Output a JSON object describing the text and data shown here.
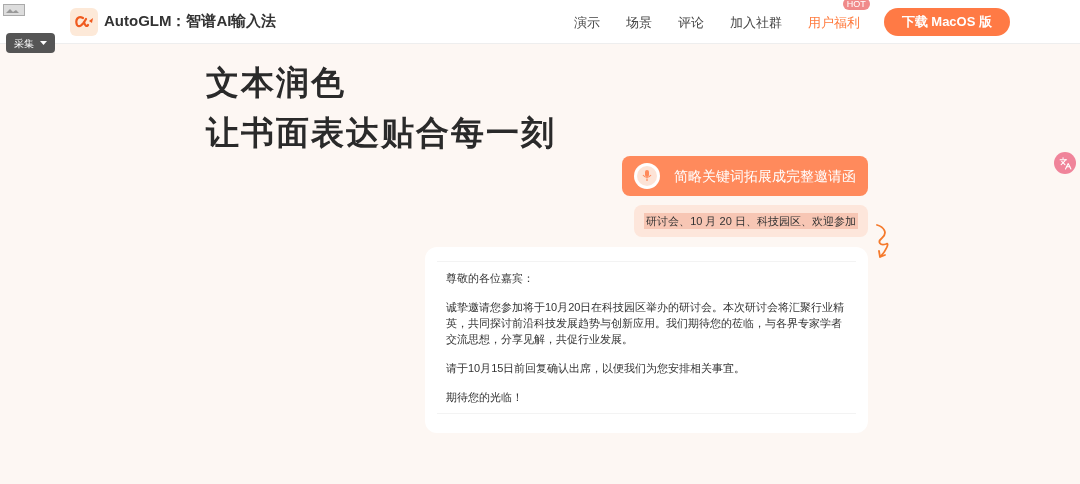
{
  "extension": {
    "label": "采集"
  },
  "brand": {
    "name": "AutoGLM：智谱AI输入法"
  },
  "nav": [
    {
      "label": "演示",
      "selected": false
    },
    {
      "label": "场景",
      "selected": false
    },
    {
      "label": "评论",
      "selected": false
    },
    {
      "label": "加入社群",
      "selected": false
    },
    {
      "label": "用户福利",
      "selected": true,
      "badge": "HOT"
    }
  ],
  "download_button": "下载 MacOS 版",
  "headline": [
    "文本润色",
    "让书面表达贴合每一刻"
  ],
  "prompt_title": "简略关键词拓展成完整邀请函",
  "keywords": "研讨会、10 月 20 日、科技园区、欢迎参加",
  "letter": [
    "尊敬的各位嘉宾：",
    "诚挚邀请您参加将于10月20日在科技园区举办的研讨会。本次研讨会将汇聚行业精英，共同探讨前沿科技发展趋势与创新应用。我们期待您的莅临，与各界专家学者交流思想，分享见解，共促行业发展。",
    "请于10月15日前回复确认出席，以便我们为您安排相关事宜。",
    "期待您的光临！"
  ]
}
